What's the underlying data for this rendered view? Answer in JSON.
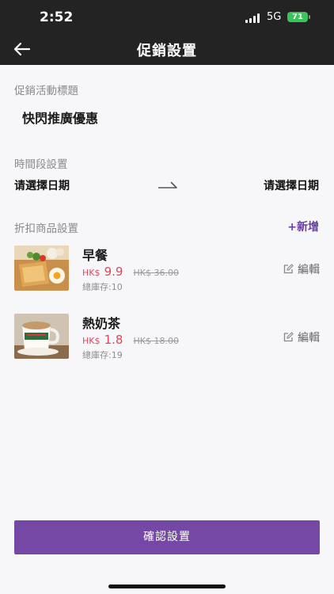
{
  "status": {
    "time": "2:52",
    "network": "5G",
    "battery": "71"
  },
  "header": {
    "title": "促銷設置"
  },
  "form": {
    "title_label": "促銷活動標題",
    "title_value": "快閃推廣優惠",
    "time_label": "時間段設置",
    "start_placeholder": "请選擇日期",
    "end_placeholder": "请選擇日期",
    "products_label": "折扣商品設置",
    "add_label": "+新增"
  },
  "products": [
    {
      "name": "早餐",
      "currency": "HK$",
      "price": "9.9",
      "original": "HK$ 36.00",
      "stock": "總庫存:10",
      "edit": "編輯"
    },
    {
      "name": "熱奶茶",
      "currency": "HK$",
      "price": "1.8",
      "original": "HK$ 18.00",
      "stock": "總庫存:19",
      "edit": "編輯"
    }
  ],
  "footer": {
    "confirm_label": "確認設置"
  },
  "colors": {
    "accent": "#7648a5",
    "price": "#e0455c",
    "header_bg": "#232323"
  }
}
